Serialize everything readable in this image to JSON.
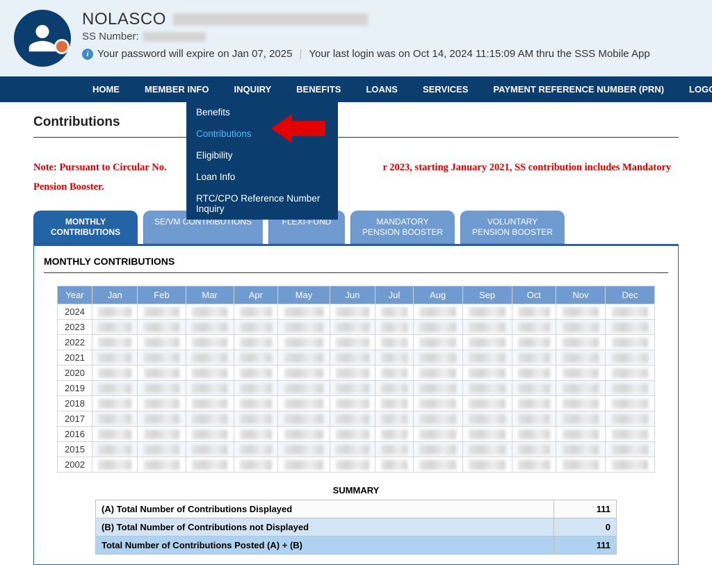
{
  "user": {
    "name": "NOLASCO",
    "ss_label": "SS Number:"
  },
  "notice": {
    "expire": "Your password will expire on Jan 07, 2025",
    "last_login": "Your last login was on Oct 14, 2024 11:15:09 AM thru the SSS Mobile App"
  },
  "nav": {
    "home": "HOME",
    "member_info": "MEMBER INFO",
    "inquiry": "INQUIRY",
    "benefits": "BENEFITS",
    "loans": "LOANS",
    "services": "SERVICES",
    "prn": "PAYMENT REFERENCE NUMBER (PRN)",
    "logout": "LOGOUT"
  },
  "inquiry_menu": {
    "benefits": "Benefits",
    "contributions": "Contributions",
    "eligibility": "Eligibility",
    "loan_info": "Loan Info",
    "rtc": "RTC/CPO Reference Number Inquiry"
  },
  "page": {
    "title": "Contributions",
    "note_prefix": "Note: Pursuant to Circular No.",
    "note_suffix": "r 2023, starting January 2021, SS contribution includes Mandatory Pension Booster."
  },
  "tabs": {
    "monthly": "MONTHLY\nCONTRIBUTIONS",
    "sevm": "SE/VM CONTRIBUTIONS",
    "flexi": "FLEXI-FUND",
    "mandatory": "MANDATORY\nPENSION BOOSTER",
    "voluntary": "VOLUNTARY\nPENSION BOOSTER"
  },
  "table": {
    "panel_title": "MONTHLY CONTRIBUTIONS",
    "headers": [
      "Year",
      "Jan",
      "Feb",
      "Mar",
      "Apr",
      "May",
      "Jun",
      "Jul",
      "Aug",
      "Sep",
      "Oct",
      "Nov",
      "Dec"
    ],
    "years": [
      "2024",
      "2023",
      "2022",
      "2021",
      "2020",
      "2019",
      "2018",
      "2017",
      "2016",
      "2015",
      "2002"
    ]
  },
  "summary": {
    "title": "SUMMARY",
    "row_a_label": "(A) Total Number of Contributions Displayed",
    "row_a_value": "111",
    "row_b_label": "(B) Total Number of Contributions not Displayed",
    "row_b_value": "0",
    "row_t_label": "Total Number of Contributions Posted (A) + (B)",
    "row_t_value": "111"
  }
}
